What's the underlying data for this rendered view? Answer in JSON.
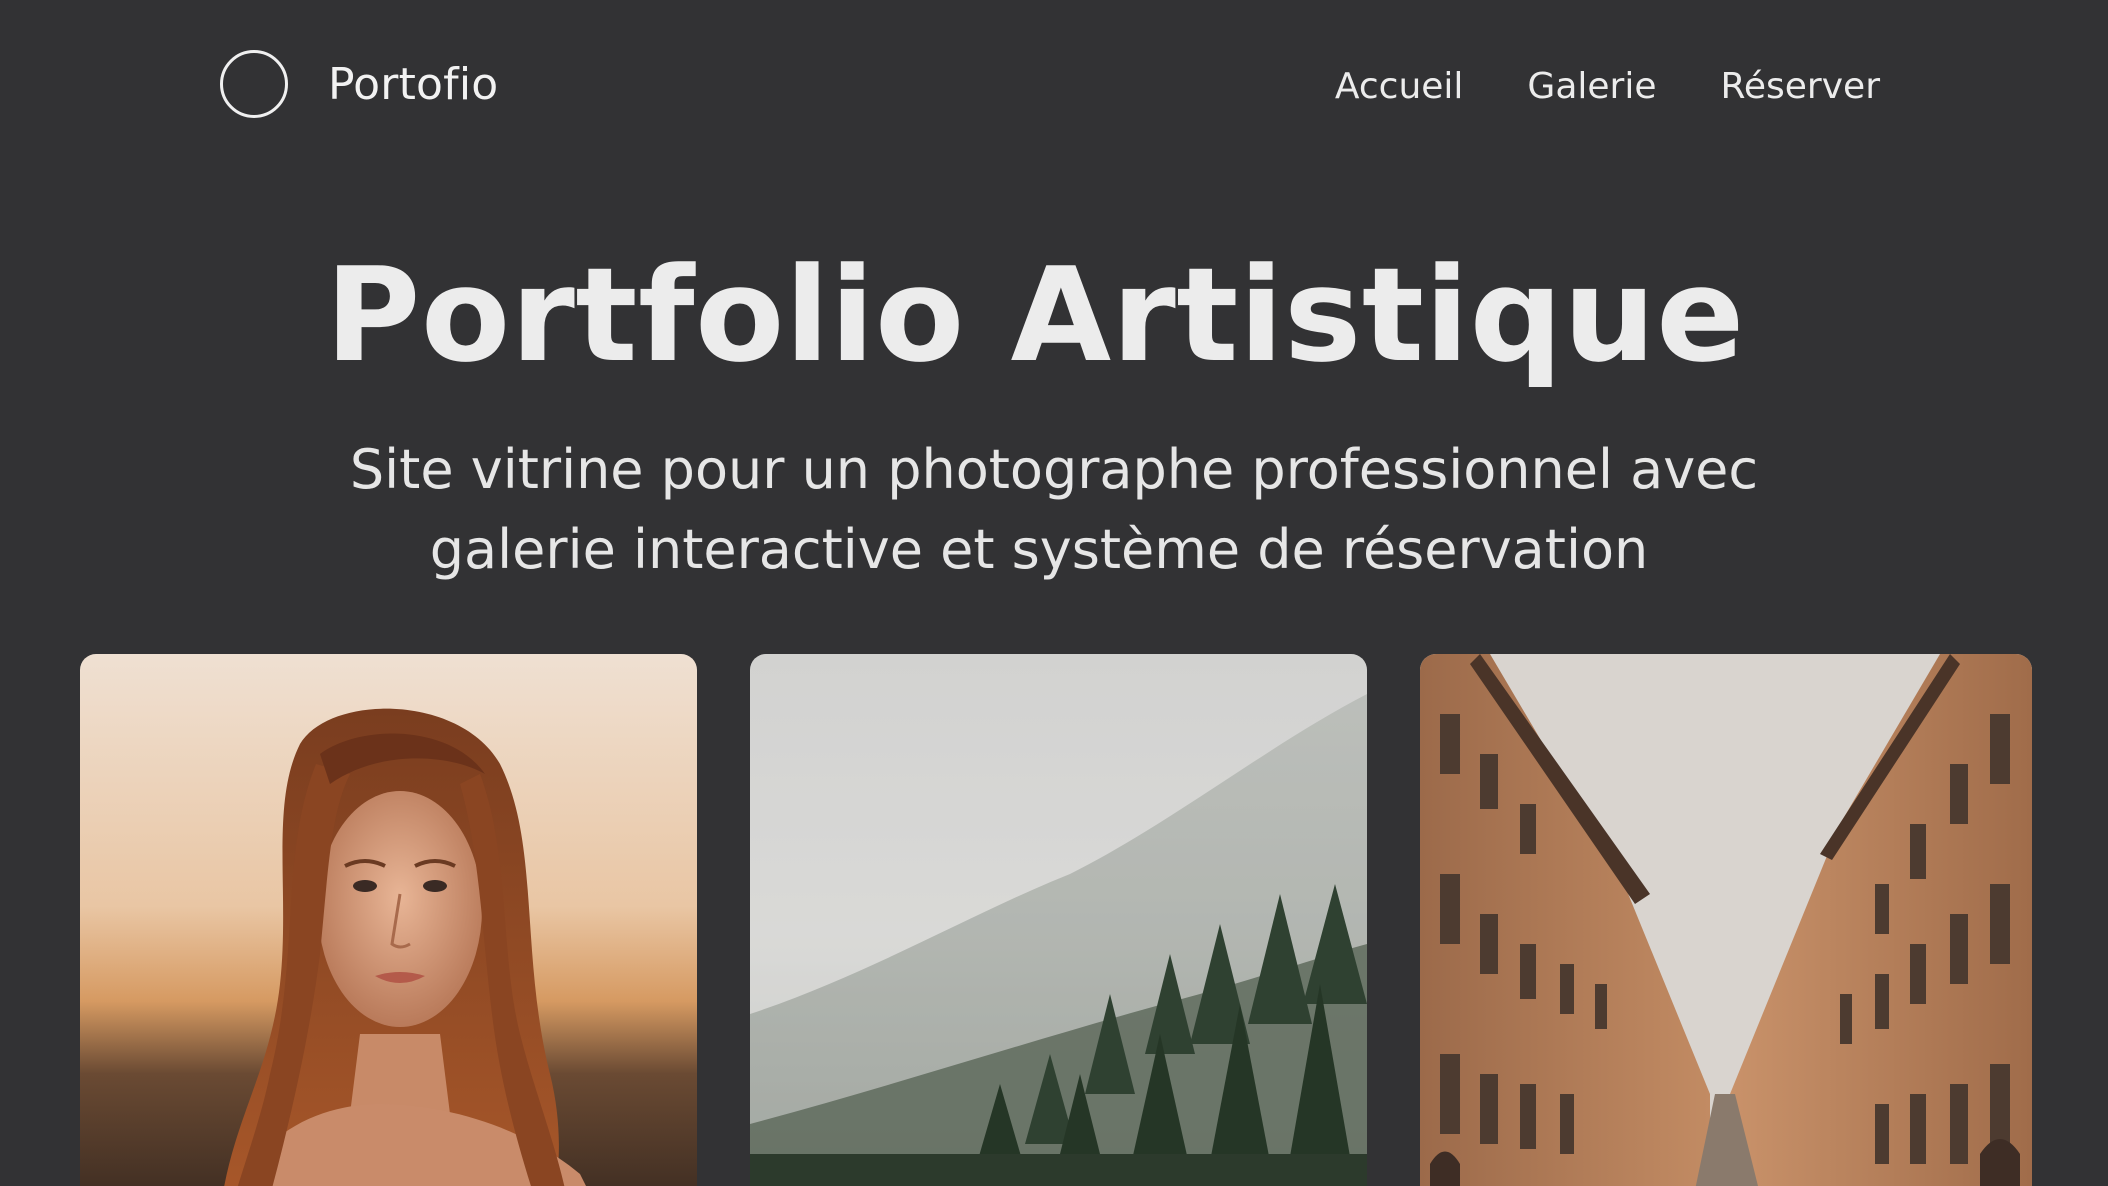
{
  "header": {
    "logo_text": "Portofio",
    "logo_icon": "circle-logo-icon",
    "nav": [
      {
        "label": "Accueil"
      },
      {
        "label": "Galerie"
      },
      {
        "label": "Réserver"
      }
    ]
  },
  "hero": {
    "title": "Portfolio Artistique",
    "subtitle_line1": "Site vitrine pour un photographe professionnel avec",
    "subtitle_line2": "galerie interactive et système de réservation"
  },
  "gallery": {
    "items": [
      {
        "subject": "portrait-photo"
      },
      {
        "subject": "misty-forest-photo"
      },
      {
        "subject": "street-architecture-photo"
      }
    ]
  },
  "colors": {
    "background": "#323234",
    "text": "#ececec"
  }
}
